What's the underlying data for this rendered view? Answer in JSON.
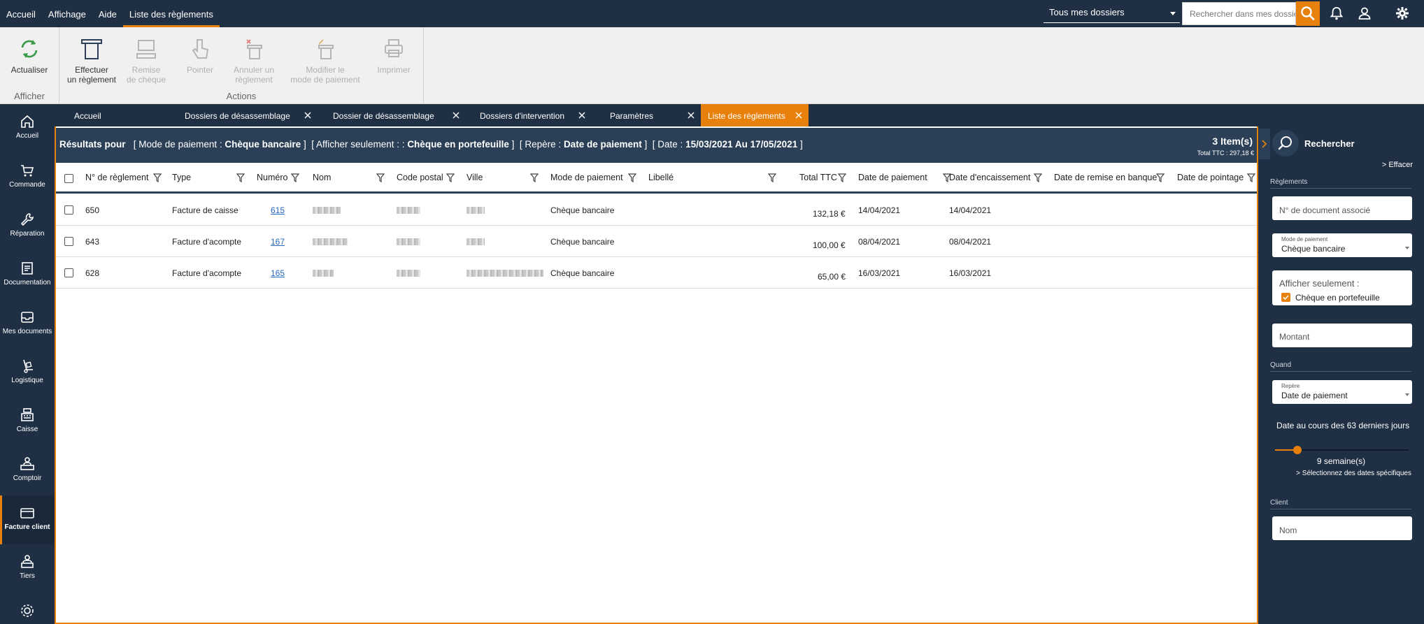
{
  "menu": [
    "Accueil",
    "Affichage",
    "Aide",
    "Liste des règlements"
  ],
  "topbar": {
    "folder_select": "Tous mes dossiers",
    "search_placeholder": "Rechercher dans mes dossiers"
  },
  "ribbon": {
    "refresh_label": "Actualiser",
    "afficher_label": "Afficher",
    "actions_label": "Actions",
    "buttons": [
      {
        "line1": "Effectuer",
        "line2": "un règlement"
      },
      {
        "line1": "Remise",
        "line2": "de chèque"
      },
      {
        "line1": "Pointer",
        "line2": ""
      },
      {
        "line1": "Annuler un",
        "line2": "règlement"
      },
      {
        "line1": "Modifier le",
        "line2": "mode de paiement"
      },
      {
        "line1": "Imprimer",
        "line2": ""
      }
    ]
  },
  "nav": [
    "Accueil",
    "Commande",
    "Réparation",
    "Documentation",
    "Mes documents",
    "Logistique",
    "Caisse",
    "Comptoir",
    "Facture client",
    "Tiers"
  ],
  "tabs": [
    "Accueil",
    "Dossiers de désassemblage",
    "Dossier de désassemblage",
    "Dossiers d'intervention",
    "Paramètres",
    "Liste des règlements"
  ],
  "criteria": {
    "prefix": "Résultats pour",
    "mode_label": "[ Mode de paiement :",
    "mode_value": "Chèque bancaire",
    "mode_close": "]",
    "afficher_label": "[ Afficher seulement : :",
    "afficher_value": "Chèque en portefeuille",
    "afficher_close": "]",
    "repere_label": "[ Repère :",
    "repere_value": "Date de paiement",
    "repere_close": "]",
    "date_label": "[ Date :",
    "date_value": "15/03/2021 Au 17/05/2021",
    "date_close": "]",
    "items": "3 Item(s)",
    "total": "Total TTC : 297,18 €"
  },
  "columns": [
    "N° de règlement",
    "Type",
    "Numéro",
    "Nom",
    "Code postal",
    "Ville",
    "Mode de paiement",
    "Libellé",
    "Total TTC",
    "Date de paiement",
    "Date d'encaissement",
    "Date de remise en banque",
    "Date de pointage"
  ],
  "rows": [
    {
      "num": "650",
      "type": "Facture de caisse",
      "numero": "615",
      "mode": "Chèque bancaire",
      "total": "132,18 €",
      "date_paiement": "14/04/2021",
      "date_encaissement": "14/04/2021"
    },
    {
      "num": "643",
      "type": "Facture d'acompte",
      "numero": "167",
      "mode": "Chèque bancaire",
      "total": "100,00 €",
      "date_paiement": "08/04/2021",
      "date_encaissement": "08/04/2021"
    },
    {
      "num": "628",
      "type": "Facture d'acompte",
      "numero": "165",
      "mode": "Chèque bancaire",
      "total": "65,00 €",
      "date_paiement": "16/03/2021",
      "date_encaissement": "16/03/2021"
    }
  ],
  "search_panel": {
    "title": "Rechercher",
    "clear": "> Effacer",
    "section_reglements": "Règlements",
    "doc_placeholder": "N° de document associé",
    "mode_label": "Mode de paiement",
    "mode_value": "Chèque bancaire",
    "afficher_label": "Afficher seulement :",
    "afficher_option": "Chèque en portefeuille",
    "afficher_checked": true,
    "montant_placeholder": "Montant",
    "section_quand": "Quand",
    "repere_label": "Repère",
    "repere_value": "Date de paiement",
    "date_caption": "Date au cours des 63 derniers jours",
    "slider_fraction": 0.17,
    "weeks": "9 semaine(s)",
    "specific_dates": "> Sélectionnez des dates spécifiques",
    "section_client": "Client",
    "nom_placeholder": "Nom"
  },
  "colors": {
    "accent": "#e8800c",
    "navy": "#1f3044",
    "header": "#2b4057",
    "link": "#2467c0"
  }
}
